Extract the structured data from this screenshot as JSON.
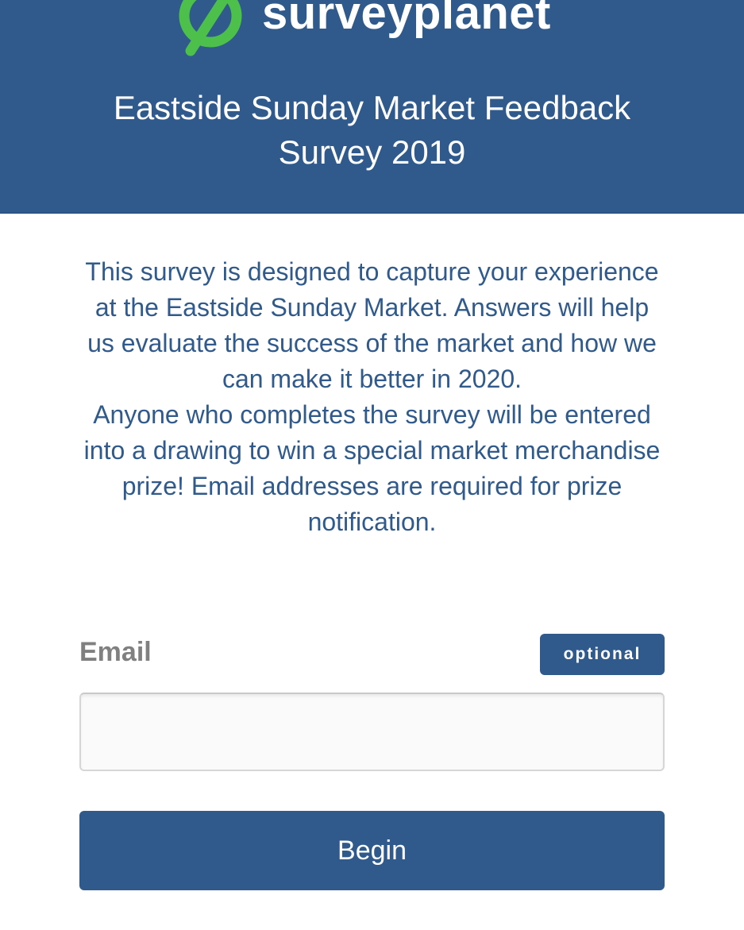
{
  "header": {
    "brand_name": "surveyplanet",
    "title": "Eastside Sunday Market Feedback Survey 2019"
  },
  "intro": {
    "paragraph1": "This survey is designed to capture your experience at the Eastside Sunday Market. Answers will help us evaluate the success of the market and how we can make it better in 2020.",
    "paragraph2": "Anyone who completes the survey will be entered into a drawing to win a special market merchandise prize! Email addresses are required for prize notification."
  },
  "form": {
    "email_label": "Email",
    "optional_badge": "optional",
    "email_value": "",
    "begin_label": "Begin"
  },
  "colors": {
    "brand_blue": "#2f5a8b",
    "logo_green": "#4cc04a",
    "label_gray": "#808080"
  },
  "icons": {
    "logo": "surveyplanet-logo-icon"
  }
}
